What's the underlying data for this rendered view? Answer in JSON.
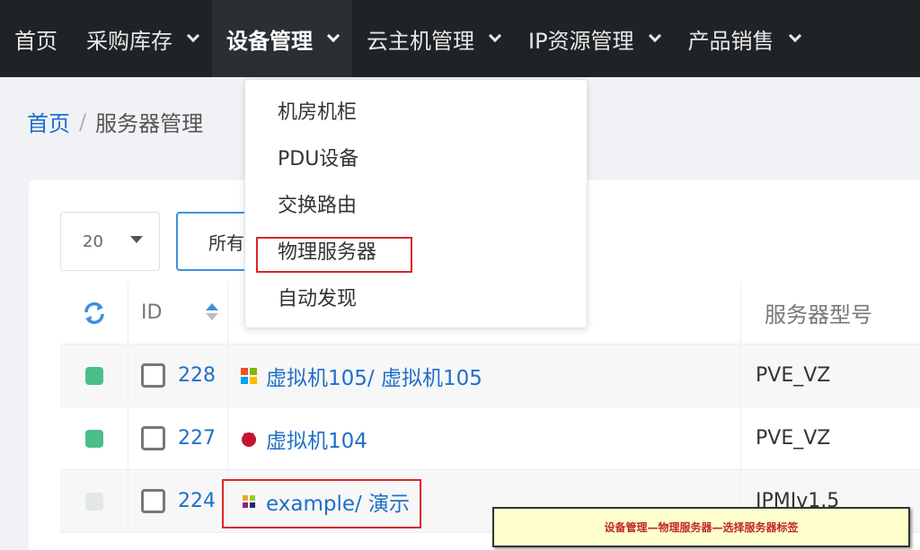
{
  "nav": {
    "items": [
      {
        "label": "首页",
        "has_dropdown": false,
        "active": false
      },
      {
        "label": "采购库存",
        "has_dropdown": true,
        "active": false
      },
      {
        "label": "设备管理",
        "has_dropdown": true,
        "active": true
      },
      {
        "label": "云主机管理",
        "has_dropdown": true,
        "active": false
      },
      {
        "label": "IP资源管理",
        "has_dropdown": true,
        "active": false
      },
      {
        "label": "产品销售",
        "has_dropdown": true,
        "active": false
      }
    ]
  },
  "breadcrumb": {
    "home": "首页",
    "separator": "/",
    "current": "服务器管理"
  },
  "toolbar": {
    "page_size": "20",
    "filter_label": "所有"
  },
  "table": {
    "headers": {
      "id": "ID",
      "model": "服务器型号"
    },
    "rows": [
      {
        "status_color": "#4cbe8a",
        "id": "228",
        "os": "windows",
        "name": "虚拟机105/ 虚拟机105",
        "model": "PVE_VZ"
      },
      {
        "status_color": "#4cbe8a",
        "id": "227",
        "os": "debian",
        "name": "虚拟机104",
        "model": "PVE_VZ"
      },
      {
        "status_color": "#e3e7ea",
        "id": "224",
        "os": "centos",
        "name": "example/ 演示",
        "model": "IPMIv1.5"
      }
    ]
  },
  "dropdown": {
    "items": [
      "机房机柜",
      "PDU设备",
      "交换路由",
      "物理服务器",
      "自动发现"
    ]
  },
  "annotation": "设备管理—物理服务器—选择服务器标签",
  "colors": {
    "nav_bg": "#1f2326",
    "link": "#1f6fc8",
    "highlight_border": "#d9262c",
    "note_bg": "#ffffcc"
  }
}
